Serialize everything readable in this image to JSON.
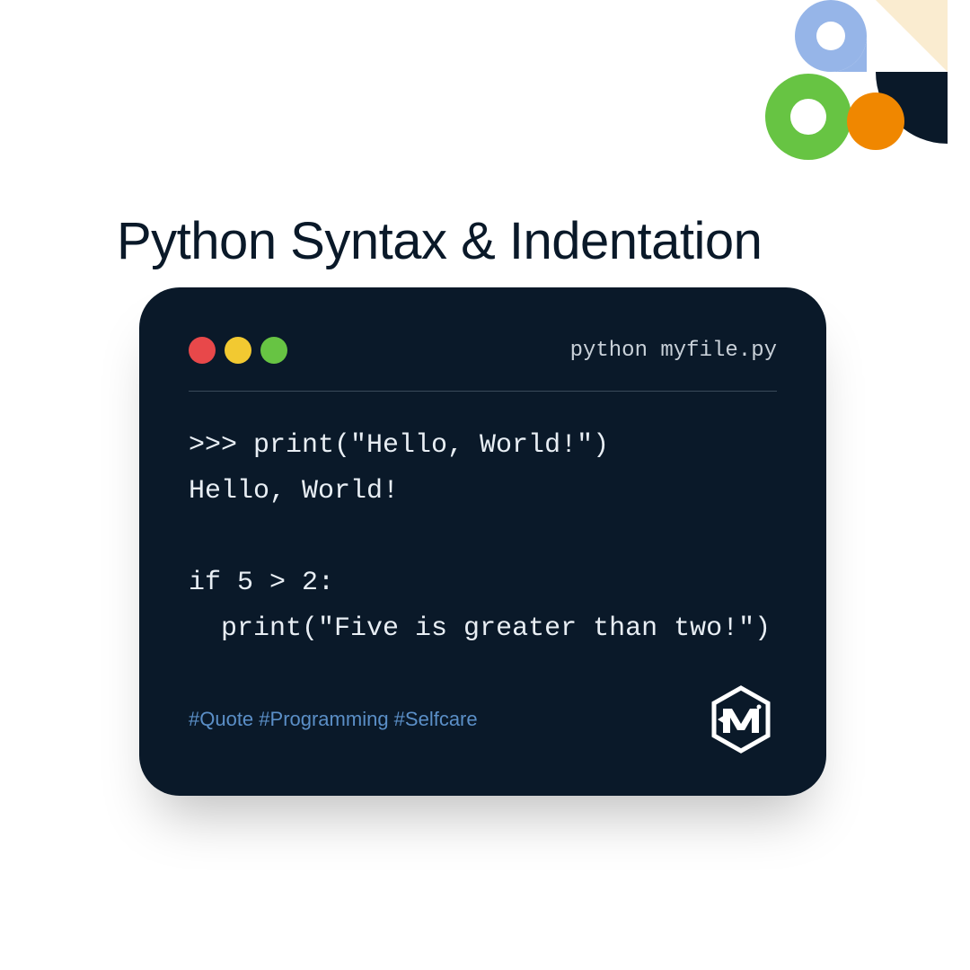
{
  "title": "Python Syntax & Indentation",
  "terminal": {
    "header_title": "python myfile.py",
    "code": ">>> print(\"Hello, World!\")\nHello, World!\n\nif 5 > 2:\n  print(\"Five is greater than two!\")",
    "hashtags": "#Quote #Programming #Selfcare"
  },
  "colors": {
    "terminal_bg": "#0a1929",
    "red": "#e8484a",
    "yellow": "#f2c931",
    "green": "#67c443",
    "orange": "#f08700",
    "blue": "#96b5e8",
    "cream": "#faecd0"
  }
}
